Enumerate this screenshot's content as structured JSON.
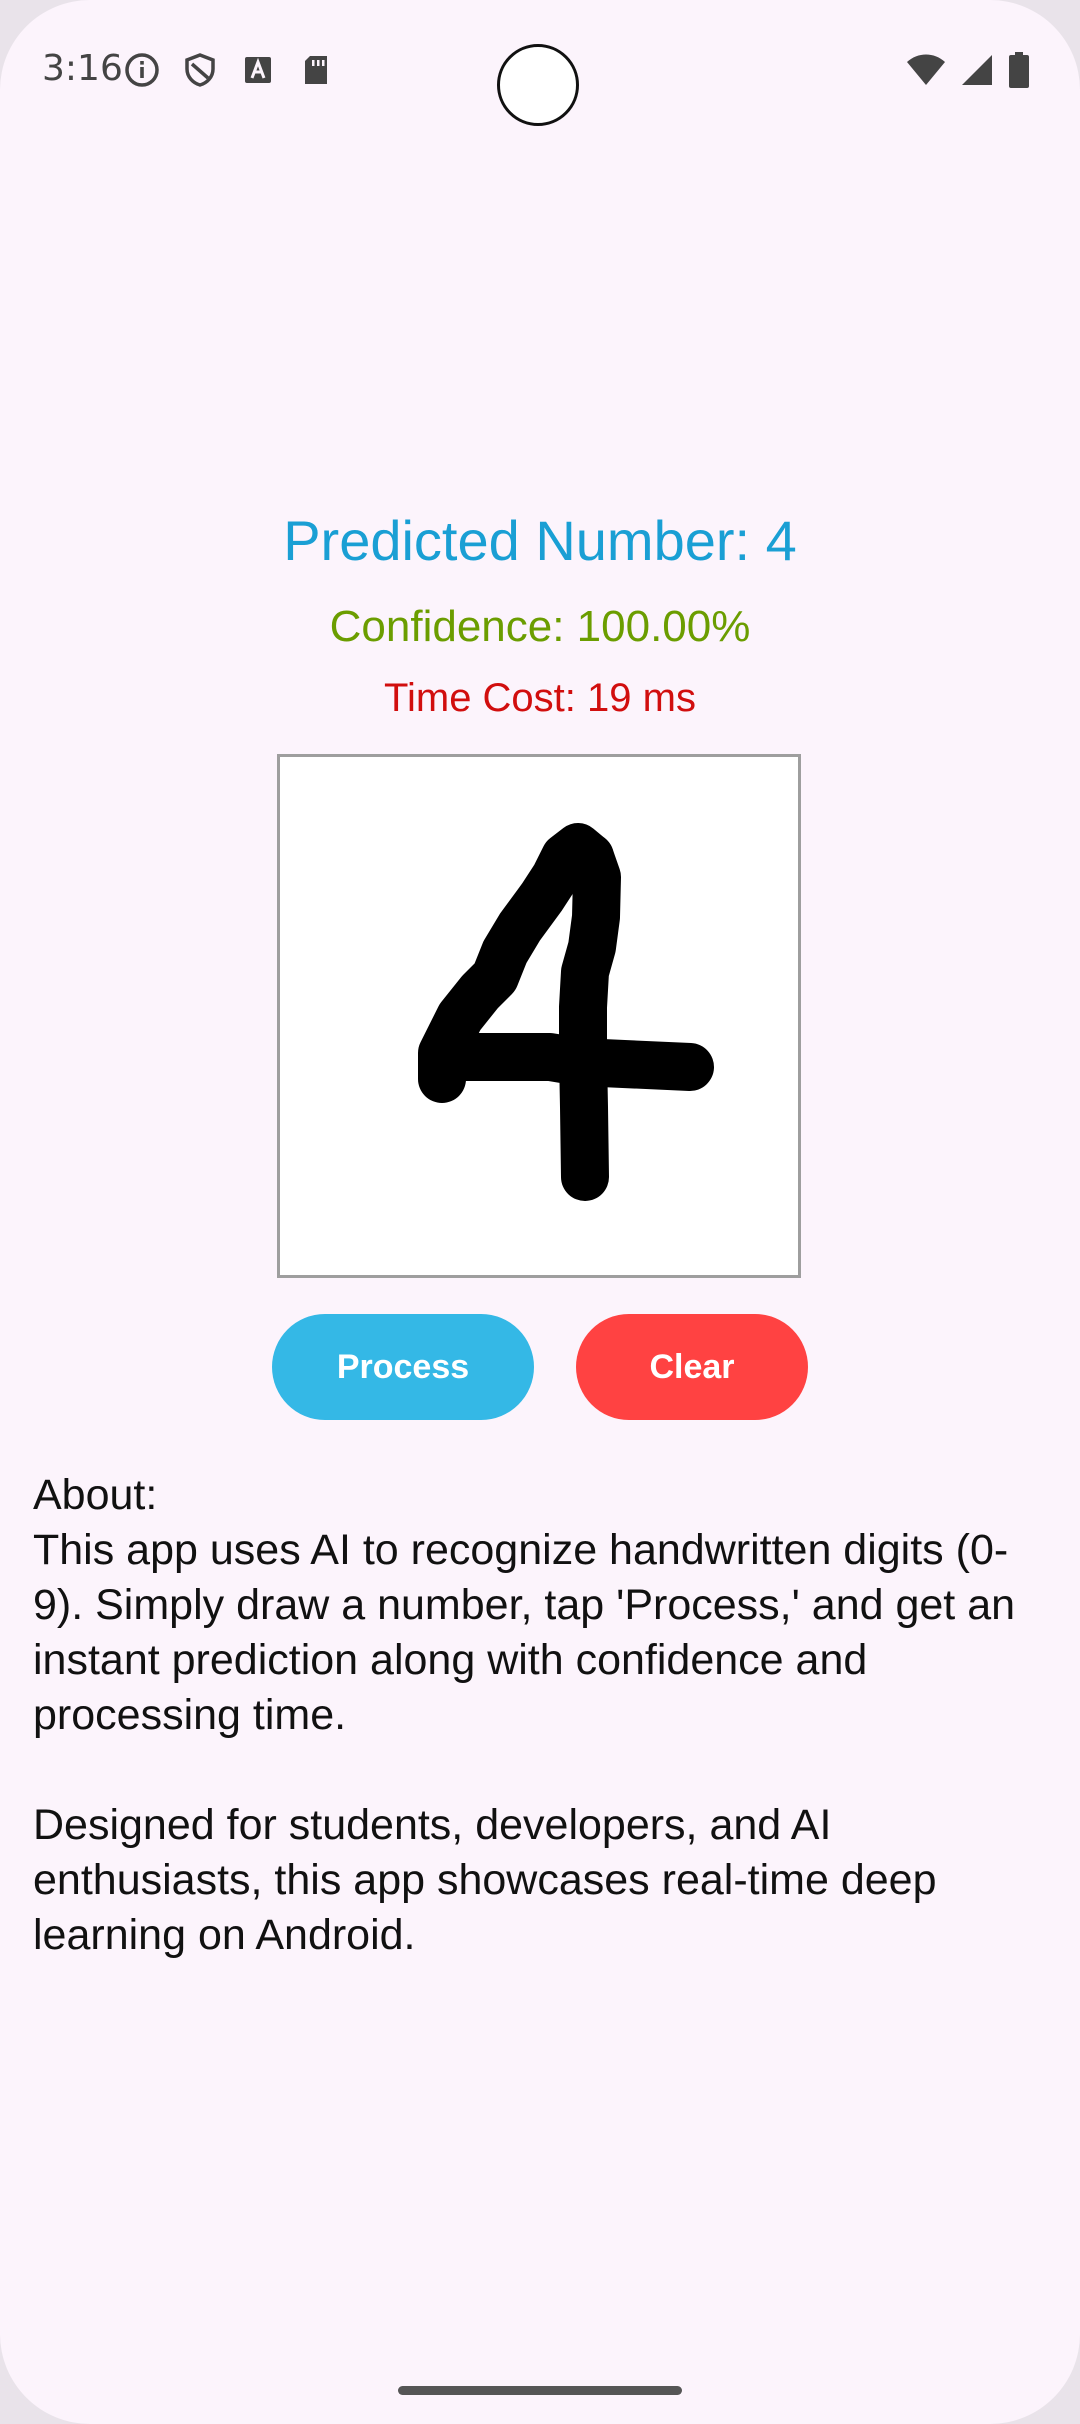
{
  "status_bar": {
    "time": "3:16",
    "left_icons": [
      "info-icon",
      "shield-icon",
      "keyboard-a-icon",
      "sd-card-icon"
    ],
    "right_icons": [
      "wifi-icon",
      "signal-icon",
      "battery-icon"
    ]
  },
  "result": {
    "predicted_label": "Predicted Number: 4",
    "confidence_label": "Confidence: 100.00%",
    "time_cost_label": "Time Cost: 19 ms",
    "colors": {
      "predicted": "#1a9fd4",
      "confidence": "#6b9d00",
      "time_cost": "#d10e0e"
    }
  },
  "drawing_canvas": {
    "drawn_digit_icon": "handwritten-4-stroke"
  },
  "buttons": {
    "process_label": "Process",
    "clear_label": "Clear",
    "process_color": "#34b8e6",
    "clear_color": "#ff4242"
  },
  "about": {
    "text": "About:\nThis app uses AI to recognize handwritten digits (0-9). Simply draw a number, tap 'Process,' and get an instant prediction along with confidence and processing time.\n\nDesigned for students, developers, and AI enthusiasts, this app showcases real-time deep learning on Android."
  }
}
